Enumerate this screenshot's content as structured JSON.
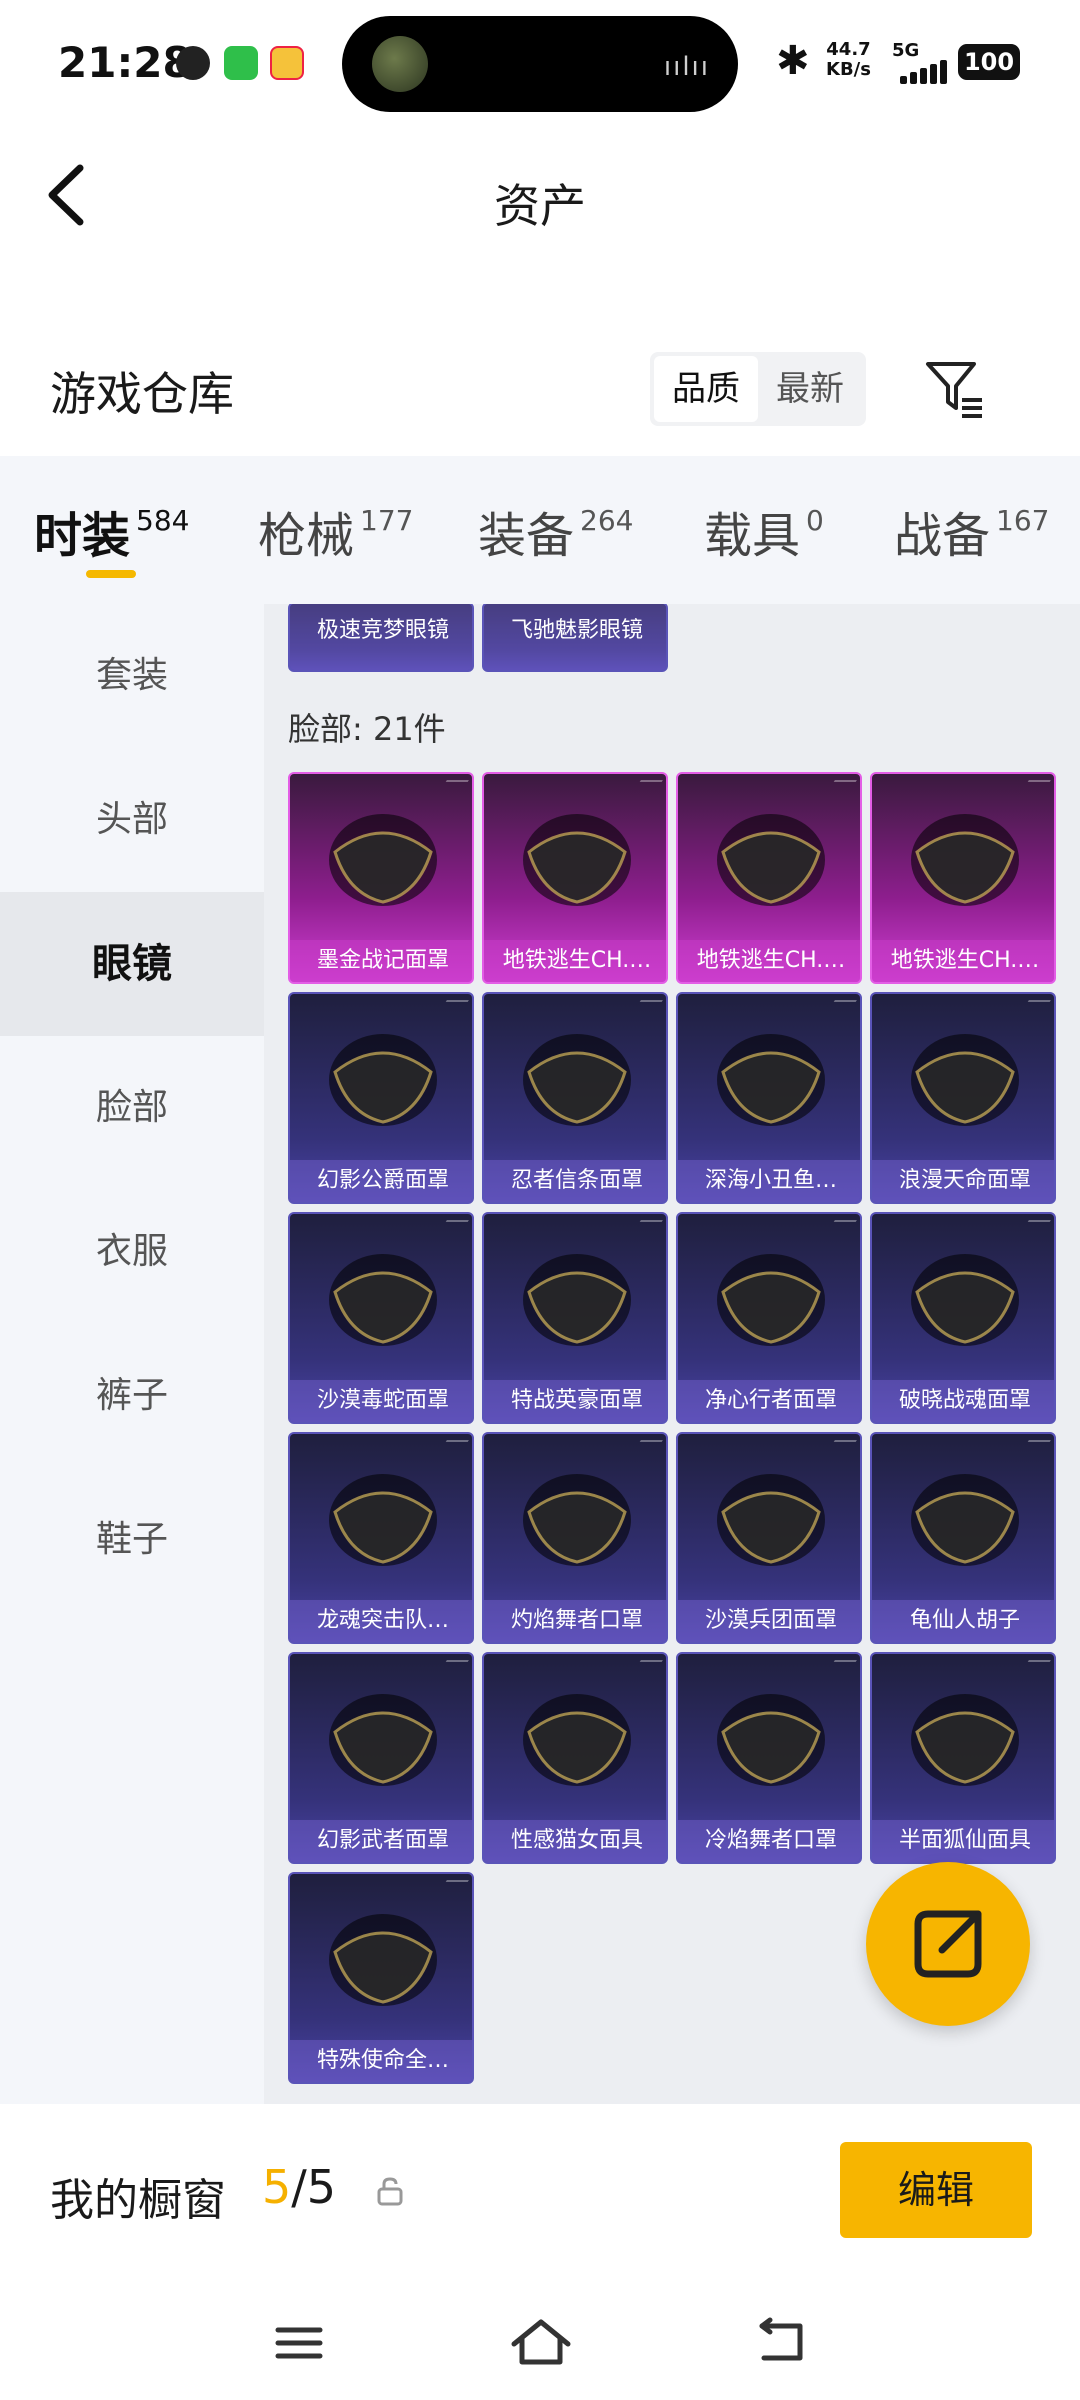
{
  "status_bar": {
    "time": "21:28",
    "net_speed_value": "44.7",
    "net_speed_unit": "KB/s",
    "network": "5G",
    "battery": "100"
  },
  "header": {
    "title": "资产",
    "back_icon": "chevron-left-icon"
  },
  "section": {
    "title": "游戏仓库",
    "sort_options": [
      "品质",
      "最新"
    ],
    "sort_selected": "品质",
    "filter_icon": "filter-icon"
  },
  "tabs": [
    {
      "label": "时装",
      "count": "584"
    },
    {
      "label": "枪械",
      "count": "177"
    },
    {
      "label": "装备",
      "count": "264"
    },
    {
      "label": "载具",
      "count": "0"
    },
    {
      "label": "战备",
      "count": "167"
    }
  ],
  "active_tab": "时装",
  "sidebar": {
    "items": [
      "套装",
      "头部",
      "眼镜",
      "脸部",
      "衣服",
      "裤子",
      "鞋子"
    ],
    "active": "眼镜"
  },
  "grid": {
    "partial_top_items": [
      "极速竞梦眼镜",
      "飞驰魅影眼镜"
    ],
    "group_heading": "脸部: 21件",
    "items": [
      {
        "name": "墨金战记面罩",
        "rarity": "legendary"
      },
      {
        "name": "地铁逃生CH.…",
        "rarity": "legendary"
      },
      {
        "name": "地铁逃生CH.…",
        "rarity": "legendary"
      },
      {
        "name": "地铁逃生CH.…",
        "rarity": "legendary"
      },
      {
        "name": "幻影公爵面罩",
        "rarity": "epic"
      },
      {
        "name": "忍者信条面罩",
        "rarity": "epic"
      },
      {
        "name": "深海小丑鱼…",
        "rarity": "epic"
      },
      {
        "name": "浪漫天命面罩",
        "rarity": "epic"
      },
      {
        "name": "沙漠毒蛇面罩",
        "rarity": "epic"
      },
      {
        "name": "特战英豪面罩",
        "rarity": "epic"
      },
      {
        "name": "净心行者面罩",
        "rarity": "epic"
      },
      {
        "name": "破晓战魂面罩",
        "rarity": "epic"
      },
      {
        "name": "龙魂突击队…",
        "rarity": "epic"
      },
      {
        "name": "灼焰舞者口罩",
        "rarity": "epic"
      },
      {
        "name": "沙漠兵团面罩",
        "rarity": "epic"
      },
      {
        "name": "龟仙人胡子",
        "rarity": "epic"
      },
      {
        "name": "幻影武者面罩",
        "rarity": "epic"
      },
      {
        "name": "性感猫女面具",
        "rarity": "epic"
      },
      {
        "name": "冷焰舞者口罩",
        "rarity": "epic"
      },
      {
        "name": "半面狐仙面具",
        "rarity": "epic"
      },
      {
        "name": "特殊使命全…",
        "rarity": "epic"
      }
    ],
    "rarity_colors": {
      "legendary": "#d13fd4",
      "epic": "#4a43a6"
    }
  },
  "fab_icon": "share-external-icon",
  "showcase": {
    "label": "我的橱窗",
    "current": "5",
    "total": "/5",
    "lock_icon": "lock-icon",
    "edit_label": "编辑"
  },
  "navbar": {
    "icons": [
      "menu-icon",
      "home-icon",
      "back-icon"
    ]
  },
  "accent_color": "#f7b500"
}
